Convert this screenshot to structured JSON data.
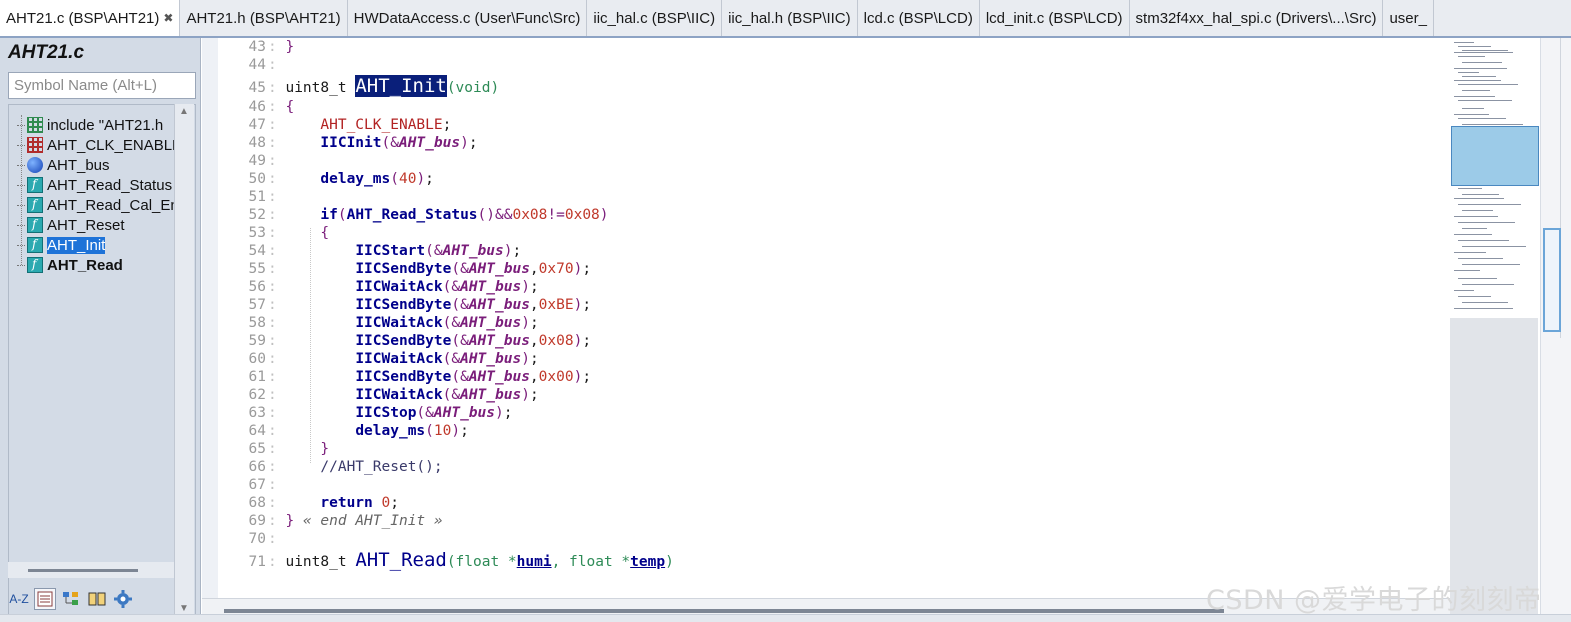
{
  "tabs": [
    {
      "label": "AHT21.c (BSP\\AHT21)",
      "active": true,
      "closable": true,
      "close_glyph": "✖"
    },
    {
      "label": "AHT21.h (BSP\\AHT21)"
    },
    {
      "label": "HWDataAccess.c (User\\Func\\Src)"
    },
    {
      "label": "iic_hal.c (BSP\\IIC)"
    },
    {
      "label": "iic_hal.h (BSP\\IIC)"
    },
    {
      "label": "lcd.c (BSP\\LCD)"
    },
    {
      "label": "lcd_init.c (BSP\\LCD)"
    },
    {
      "label": "stm32f4xx_hal_spi.c (Drivers\\...\\Src)"
    },
    {
      "label": "user_"
    }
  ],
  "symbol_panel": {
    "title": "AHT21.c",
    "search_placeholder": "Symbol Name (Alt+L)",
    "items": [
      {
        "label": "include \"AHT21.h",
        "icon": "include-icon",
        "kind": "grid"
      },
      {
        "label": "AHT_CLK_ENABLE",
        "icon": "define-icon",
        "kind": "define"
      },
      {
        "label": "AHT_bus",
        "icon": "variable-icon",
        "kind": "var"
      },
      {
        "label": "AHT_Read_Status",
        "icon": "function-icon",
        "kind": "func"
      },
      {
        "label": "AHT_Read_Cal_En",
        "icon": "function-icon",
        "kind": "func"
      },
      {
        "label": "AHT_Reset",
        "icon": "function-icon",
        "kind": "func"
      },
      {
        "label": "AHT_Init",
        "icon": "function-icon",
        "kind": "func",
        "selected": true
      },
      {
        "label": "AHT_Read",
        "icon": "function-icon",
        "kind": "func",
        "bold": true
      }
    ],
    "toolbar": {
      "sort_label": "A-Z",
      "tools": [
        "list-view-icon",
        "tree-view-icon",
        "book-icon",
        "gear-icon"
      ]
    }
  },
  "editor": {
    "lines": [
      {
        "n": "43",
        "html": "<span class=\"op\">}</span>"
      },
      {
        "n": "44",
        "html": ""
      },
      {
        "n": "45",
        "big": true,
        "html": "uint8_t <span class=\"fn-decl sel\">AHT_Init</span><span class=\"kw\">(void)</span>"
      },
      {
        "n": "46",
        "html": "<span class=\"op\">{</span>"
      },
      {
        "n": "47",
        "html": "    <span class=\"macro\">AHT_CLK_ENABLE</span>;"
      },
      {
        "n": "48",
        "html": "    <span class=\"fn\">IICInit</span><span class=\"op\">(&amp;</span><span class=\"var\">AHT_bus</span><span class=\"op\">)</span>;"
      },
      {
        "n": "49",
        "html": ""
      },
      {
        "n": "50",
        "html": "    <span class=\"fn\">delay_ms</span><span class=\"op\">(</span><span class=\"num\">40</span><span class=\"op\">)</span>;"
      },
      {
        "n": "51",
        "html": ""
      },
      {
        "n": "52",
        "html": "    <span class=\"kw-bold\">if</span><span class=\"op\">(</span><span class=\"fn\">AHT_Read_Status</span><span class=\"op\">()&amp;&amp;</span><span class=\"num\">0x08</span><span class=\"op\">!=</span><span class=\"num\">0x08</span><span class=\"op\">)</span>"
      },
      {
        "n": "53",
        "html": "    <span class=\"op\">{</span>"
      },
      {
        "n": "54",
        "html": "        <span class=\"fn\">IICStart</span><span class=\"op\">(&amp;</span><span class=\"var\">AHT_bus</span><span class=\"op\">)</span>;"
      },
      {
        "n": "55",
        "html": "        <span class=\"fn\">IICSendByte</span><span class=\"op\">(&amp;</span><span class=\"var\">AHT_bus</span>,<span class=\"num\">0x70</span><span class=\"op\">)</span>;"
      },
      {
        "n": "56",
        "html": "        <span class=\"fn\">IICWaitAck</span><span class=\"op\">(&amp;</span><span class=\"var\">AHT_bus</span><span class=\"op\">)</span>;"
      },
      {
        "n": "57",
        "html": "        <span class=\"fn\">IICSendByte</span><span class=\"op\">(&amp;</span><span class=\"var\">AHT_bus</span>,<span class=\"num\">0xBE</span><span class=\"op\">)</span>;"
      },
      {
        "n": "58",
        "html": "        <span class=\"fn\">IICWaitAck</span><span class=\"op\">(&amp;</span><span class=\"var\">AHT_bus</span><span class=\"op\">)</span>;"
      },
      {
        "n": "59",
        "html": "        <span class=\"fn\">IICSendByte</span><span class=\"op\">(&amp;</span><span class=\"var\">AHT_bus</span>,<span class=\"num\">0x08</span><span class=\"op\">)</span>;"
      },
      {
        "n": "60",
        "html": "        <span class=\"fn\">IICWaitAck</span><span class=\"op\">(&amp;</span><span class=\"var\">AHT_bus</span><span class=\"op\">)</span>;"
      },
      {
        "n": "61",
        "html": "        <span class=\"fn\">IICSendByte</span><span class=\"op\">(&amp;</span><span class=\"var\">AHT_bus</span>,<span class=\"num\">0x00</span><span class=\"op\">)</span>;"
      },
      {
        "n": "62",
        "html": "        <span class=\"fn\">IICWaitAck</span><span class=\"op\">(&amp;</span><span class=\"var\">AHT_bus</span><span class=\"op\">)</span>;"
      },
      {
        "n": "63",
        "html": "        <span class=\"fn\">IICStop</span><span class=\"op\">(&amp;</span><span class=\"var\">AHT_bus</span><span class=\"op\">)</span>;"
      },
      {
        "n": "64",
        "html": "        <span class=\"fn\">delay_ms</span><span class=\"op\">(</span><span class=\"num\">10</span><span class=\"op\">)</span>;"
      },
      {
        "n": "65",
        "html": "    <span class=\"op\">}</span>"
      },
      {
        "n": "66",
        "html": "    <span class=\"comment\">//AHT_Reset();</span>"
      },
      {
        "n": "67",
        "html": ""
      },
      {
        "n": "68",
        "html": "    <span class=\"kw-bold\">return</span> <span class=\"num\">0</span>;"
      },
      {
        "n": "69",
        "html": "<span class=\"op\">}</span> <span class=\"fold-note\">« end AHT_Init »</span>"
      },
      {
        "n": "70",
        "html": ""
      },
      {
        "n": "71",
        "big": true,
        "html": "uint8_t <span class=\"fn-decl\">AHT_Read</span><span class=\"kw\">(float *</span><span class=\"param\">humi</span><span class=\"kw\">, float *</span><span class=\"param\">temp</span><span class=\"kw\">)</span>"
      }
    ]
  },
  "watermark": "CSDN @爱学电子的刻刻帝",
  "colors": {
    "selection_bg": "#0a1f7a",
    "symbol_selected_bg": "#1e73d8",
    "function_name": "#00008b",
    "macro": "#b22222",
    "number": "#c0392b",
    "variable": "#7a1d7a",
    "type": "#2e8b57"
  }
}
